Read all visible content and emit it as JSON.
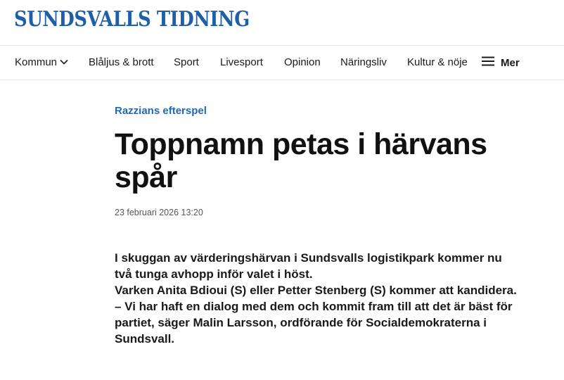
{
  "brand": {
    "logo_text": "SUNDSVALLS TIDNING",
    "color": "#1e5fa8"
  },
  "nav": {
    "items": [
      {
        "label": "Kommun",
        "icon": "chevron-down-icon"
      },
      {
        "label": "Blåljus & brott"
      },
      {
        "label": "Sport"
      },
      {
        "label": "Livesport"
      },
      {
        "label": "Opinion"
      },
      {
        "label": "Näringsliv"
      },
      {
        "label": "Kultur & nöje"
      }
    ],
    "menu": {
      "label": "Mer",
      "icon": "hamburger-menu-icon"
    }
  },
  "article": {
    "kicker": "Razzians efterspel",
    "kicker_color": "#1e68b4",
    "headline_line1": "Toppnamn petas i härvans",
    "headline_line2": "spår",
    "dateline": "23 februari 2026 13:20",
    "lead": [
      "I skuggan av värderingshärvan i Sundsvalls logistikpark kommer nu två tunga avhopp inför valet i höst.",
      "Varken Anita Bdioui (S) eller Petter Stenberg (S) kommer att kandidera.",
      "– Vi har haft en dialog med dem och kommit fram till att det är bäst för partiet, säger Malin Larsson, ordförande för Socialdemokraterna i Sundsvall."
    ]
  }
}
